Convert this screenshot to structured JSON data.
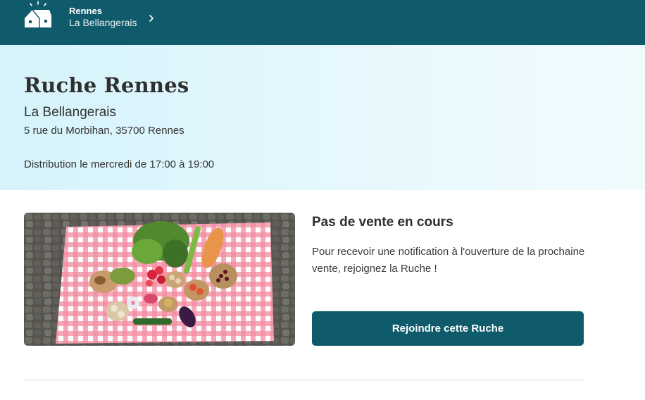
{
  "header": {
    "city": "Rennes",
    "hive_name": "La Bellangerais",
    "icons": {
      "hive": "house-icon",
      "chevron": "chevron-right-icon"
    },
    "background": "#0f5b6b"
  },
  "hero": {
    "title": "Ruche Rennes",
    "subtitle": "La Bellangerais",
    "address": "5 rue du Morbihan, 35700 Rennes",
    "distribution": "Distribution le mercredi de 17:00 à 19:00"
  },
  "sale": {
    "title": "Pas de vente en cours",
    "description": "Pour recevoir une notification à l'ouverture de la prochaine vente, rejoignez la Ruche !",
    "join_label": "Rejoindre cette Ruche",
    "accent": "#0f5b6b"
  }
}
